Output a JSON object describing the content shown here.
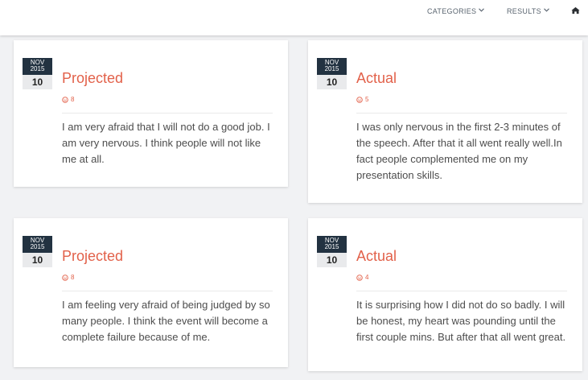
{
  "nav": {
    "categories_label": "CATEGORIES",
    "results_label": "RESULTS",
    "chevron": "⌄"
  },
  "cards": [
    {
      "date": {
        "month": "NOV",
        "year": "2015",
        "day": "10"
      },
      "title": "Projected",
      "score": "8",
      "text": "I am very afraid that I will not do a good job. I am very nervous. I think people will not like me at all."
    },
    {
      "date": {
        "month": "NOV",
        "year": "2015",
        "day": "10"
      },
      "title": "Actual",
      "score": "5",
      "text": "I was only nervous in the first 2-3 minutes of the speech. After that it all went really well.In fact people complemented me on my presentation skills."
    },
    {
      "date": {
        "month": "NOV",
        "year": "2015",
        "day": "10"
      },
      "title": "Projected",
      "score": "8",
      "text": "I am feeling very afraid of being judged by so many people. I think the event will become a complete failure because of me."
    },
    {
      "date": {
        "month": "NOV",
        "year": "2015",
        "day": "10"
      },
      "title": "Actual",
      "score": "4",
      "text": "It is surprising how I did not do so badly. I will be honest, my heart was pounding until the first couple mins. But after that all went great."
    }
  ],
  "colors": {
    "accent": "#e2614a",
    "date_header": "#223241",
    "background": "#f1f2f4"
  },
  "icons": {
    "score": "smile-icon",
    "home": "home-icon",
    "dropdown": "chevron-down-icon"
  }
}
